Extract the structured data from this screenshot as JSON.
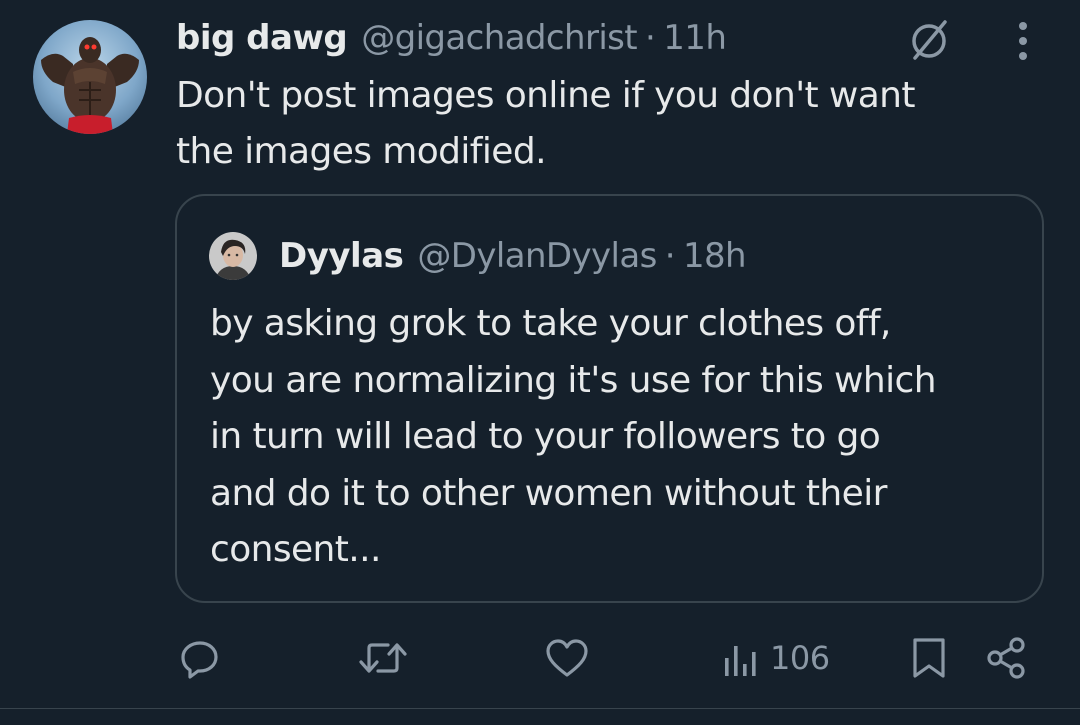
{
  "tweet": {
    "author": {
      "display_name": "big dawg",
      "handle": "@gigachadchrist",
      "avatar_icon": "muscular-figure-avatar"
    },
    "separator": "·",
    "time": "11h",
    "grok_icon": "grok-icon",
    "more_icon": "more-vertical-icon",
    "text_lines": [
      "Don't post images online if you don't want",
      "the images modified."
    ]
  },
  "quoted_tweet": {
    "author": {
      "display_name": "Dyylas",
      "handle": "@DylanDyylas",
      "avatar_icon": "profile-photo-avatar"
    },
    "separator": "·",
    "time": "18h",
    "text_lines": [
      "by asking grok to take your clothes off,",
      "you are normalizing it's use for this which",
      "in turn will lead to your followers to go",
      "and do it to other women without their",
      "consent..."
    ]
  },
  "actions": {
    "reply_icon": "reply-icon",
    "retweet_icon": "retweet-icon",
    "like_icon": "heart-icon",
    "views_icon": "views-chart-icon",
    "views_count": "106",
    "bookmark_icon": "bookmark-icon",
    "share_icon": "share-icon"
  },
  "colors": {
    "background": "#15202b",
    "text_primary": "#e7e9ea",
    "text_secondary": "#8b98a5",
    "border": "#38444d"
  }
}
